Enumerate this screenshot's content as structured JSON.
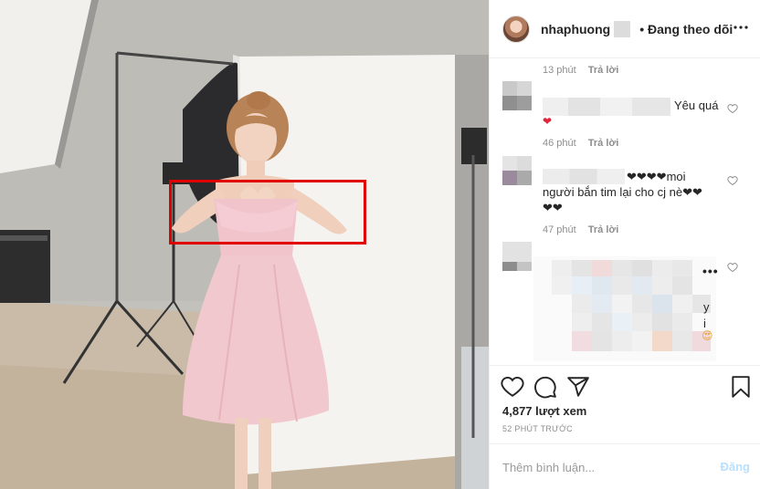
{
  "post": {
    "username": "nhaphuong",
    "follow_status": "• Đang theo dõi"
  },
  "comments": [
    {
      "time": "13 phút",
      "reply": "Trả lời",
      "text": "Yêu quá",
      "heart": "❤"
    },
    {
      "time": "46 phút",
      "reply": "Trả lời",
      "text_a": "❤❤❤❤moi",
      "text_b": "người bắn tim lại cho cj nè❤❤",
      "text_c": "❤❤"
    },
    {
      "time": "47 phút",
      "reply": "Trả lời",
      "more": "•••",
      "fragments": [
        "y",
        "i"
      ]
    }
  ],
  "actions": {
    "likes": "4,877 lượt xem",
    "timestamp": "52 PHÚT TRƯỚC"
  },
  "composer": {
    "placeholder": "Thêm bình luận...",
    "post_label": "Đăng"
  },
  "icons": [
    "more-icon",
    "heart-icon",
    "comment-icon",
    "share-icon",
    "bookmark-icon"
  ],
  "colors": {
    "highlight": "#e00000",
    "heart": "#e0243a",
    "post_disabled": "#b9dffc"
  }
}
